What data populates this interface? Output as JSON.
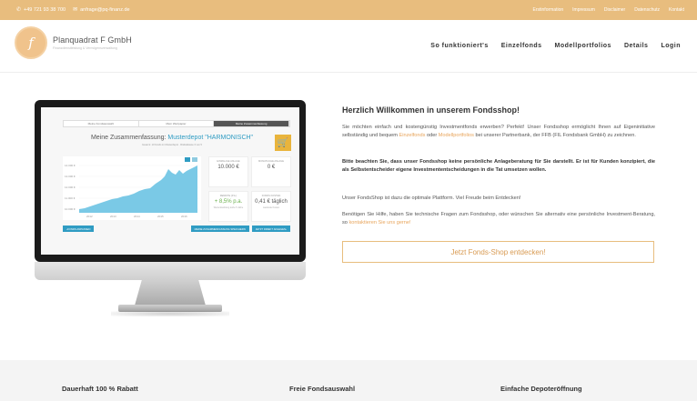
{
  "topbar": {
    "phone": "+49 721 93 38 700",
    "email": "anfrage@pq-finanz.de",
    "links": [
      "Erstinformation",
      "Impressum",
      "Disclaimer",
      "Datenschutz",
      "Kontakt"
    ],
    "color": "#e8bd7e"
  },
  "logo": {
    "letter": "f",
    "name": "Planquadrat F GmbH",
    "tagline": "Finanzdienstleistung & Vermögensverwaltung"
  },
  "nav": {
    "items": [
      "So funktioniert's",
      "Einzelfonds",
      "Modellportfolios",
      "Details",
      "Login"
    ]
  },
  "screen": {
    "steps": [
      "Meine Fondsauswahl",
      "Mein Wertpapier",
      "Meine Zusammenfassung"
    ],
    "summary_prefix": "Meine Zusammenfassung:",
    "summary_accent": "Musterdepot \"HARMONISCH\"",
    "summary_sub": "Gesamt: 10 Fonds im Musterdepot · Risikoklasse 3 von 5",
    "y_ticks": [
      "14.000 €",
      "13.000 €",
      "12.000 €",
      "11.000 €",
      "10.000 €"
    ],
    "x_ticks": [
      "2012",
      "2013",
      "2014",
      "2015",
      "2016"
    ],
    "kpis": [
      {
        "label": "EINMALIGE ANLAGE",
        "value": "10.000 €",
        "note": ""
      },
      {
        "label": "MONATLICHE ANLAGE",
        "value": "0 €",
        "note": ""
      },
      {
        "label": "RENDITE (P.A.)",
        "value": "+ 8,5% p.a.",
        "note": "Wertentwicklung letzte 5 Jahre"
      },
      {
        "label": "FONDS KOSTEN",
        "value": "0,41 € täglich",
        "note": "Laufende Kosten"
      }
    ],
    "back_button": "FONDS ANPASSEN",
    "save_button": "MEINE ZUSAMMENFASSUNG SPEICHERN",
    "invest_button": "JETZT DIREKT ANLEGEN"
  },
  "hero": {
    "title": "Herzlich Willkommen in unserem Fondsshop!",
    "p1_a": "Sie möchten einfach und kostengünstig Investmentfonds erwerben? Perfekt! Unser Fondsshop ermöglicht Ihnen auf Eigeninitiative selbständig und bequem ",
    "p1_link1": "Einzelfonds",
    "p1_b": " oder ",
    "p1_link2": "Modellportfolios",
    "p1_c": " bei unserer Partnerbank, der FFB (FIL Fondsbank GmbH) zu zeichnen.",
    "p2": "Bitte beachten Sie, dass unser Fondsshop keine persönliche Anlageberatung für Sie darstellt. Er ist für Kunden konzipiert, die als Selbstentscheider eigene Investmententscheidungen in die Tat umsetzen wollen.",
    "p3": "Unser FondsShop ist dazu die optimale Plattform. Viel Freude beim Entdecken!",
    "p4_a": "Benötigen Sie Hilfe, haben Sie technische Fragen zum Fondsshop, oder wünschen Sie alternativ eine persönliche Investment-Beratung, so ",
    "p4_link": "kontaktieren Sie uns gerne!",
    "cta": "Jetzt Fonds-Shop entdecken!"
  },
  "features": [
    "Dauerhaft 100 % Rabatt",
    "Freie Fondsauswahl",
    "Einfache Depoteröffnung"
  ]
}
